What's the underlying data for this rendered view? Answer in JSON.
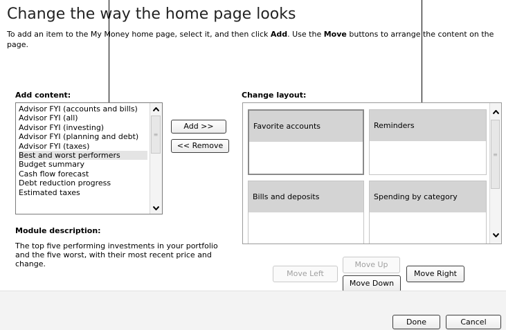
{
  "header": {
    "title": "Change the way the home page looks",
    "instructions": {
      "part1": "To add an item to the My Money home page, select it, and then click ",
      "add_word": "Add",
      "part2": ". Use the ",
      "move_word": "Move",
      "part3": " buttons to arrange the content on the page."
    }
  },
  "add_content": {
    "label": "Add content:",
    "items": [
      "Advisor FYI (accounts and bills)",
      "Advisor FYI (all)",
      "Advisor FYI (investing)",
      "Advisor FYI (planning and debt)",
      "Advisor FYI (taxes)",
      "Best and worst performers",
      "Budget summary",
      "Cash flow forecast",
      "Debt reduction progress",
      "Estimated taxes"
    ],
    "selected_item": "Best and worst performers"
  },
  "buttons": {
    "add": "Add >>",
    "remove": "<< Remove",
    "move_left": "Move Left",
    "move_up": "Move Up",
    "move_down": "Move Down",
    "move_right": "Move Right",
    "done": "Done",
    "cancel": "Cancel"
  },
  "change_layout": {
    "label": "Change layout:",
    "tiles": [
      "Favorite accounts",
      "Reminders",
      "Bills and deposits",
      "Spending by category"
    ],
    "selected_tile": "Favorite accounts"
  },
  "module_description": {
    "label": "Module description:",
    "text": "The top five performing investments in your portfolio and the five worst, with their most recent price and change."
  },
  "icons": {
    "scroll_up": "chevron-up-icon",
    "scroll_down": "chevron-down-icon"
  }
}
